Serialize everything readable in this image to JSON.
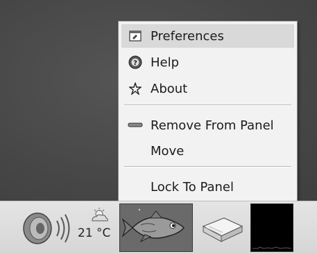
{
  "menu": {
    "items": [
      {
        "label": "Preferences",
        "icon": "preferences-icon",
        "selected": true
      },
      {
        "label": "Help",
        "icon": "help-icon"
      },
      {
        "label": "About",
        "icon": "about-icon"
      },
      {
        "label": "Remove From Panel",
        "icon": "remove-icon"
      },
      {
        "label": "Move",
        "icon": ""
      },
      {
        "label": "Lock To Panel",
        "icon": ""
      }
    ]
  },
  "panel": {
    "volume_icon": "speaker-icon",
    "weather_icon": "partly-cloudy-icon",
    "temperature": "21 °C",
    "fish_applet_icon": "fish-icon",
    "notes_icon": "sticky-notes-icon",
    "monitor_icon": "system-monitor-icon"
  }
}
